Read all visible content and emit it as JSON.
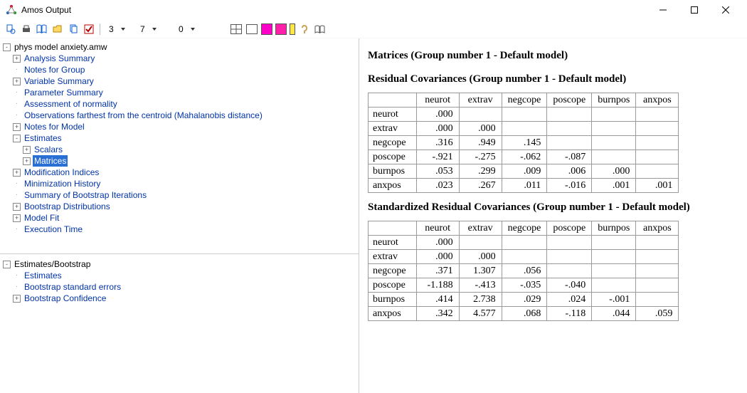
{
  "window": {
    "title": "Amos Output"
  },
  "toolbar": {
    "combo1": "3",
    "combo2": "7",
    "combo3": "0"
  },
  "tree1": [
    {
      "depth": 0,
      "twisty": "-",
      "label": "phys model anxiety.amw",
      "black": true
    },
    {
      "depth": 1,
      "twisty": "+",
      "label": "Analysis Summary"
    },
    {
      "depth": 1,
      "twisty": "",
      "label": "Notes for Group"
    },
    {
      "depth": 1,
      "twisty": "+",
      "label": "Variable Summary"
    },
    {
      "depth": 1,
      "twisty": "",
      "label": "Parameter Summary"
    },
    {
      "depth": 1,
      "twisty": "",
      "label": "Assessment of normality"
    },
    {
      "depth": 1,
      "twisty": "",
      "label": "Observations farthest from the centroid (Mahalanobis distance)"
    },
    {
      "depth": 1,
      "twisty": "+",
      "label": "Notes for Model"
    },
    {
      "depth": 1,
      "twisty": "-",
      "label": "Estimates"
    },
    {
      "depth": 2,
      "twisty": "+",
      "label": "Scalars"
    },
    {
      "depth": 2,
      "twisty": "+",
      "label": "Matrices",
      "selected": true
    },
    {
      "depth": 1,
      "twisty": "+",
      "label": "Modification Indices"
    },
    {
      "depth": 1,
      "twisty": "",
      "label": "Minimization History"
    },
    {
      "depth": 1,
      "twisty": "",
      "label": "Summary of Bootstrap Iterations"
    },
    {
      "depth": 1,
      "twisty": "+",
      "label": "Bootstrap Distributions"
    },
    {
      "depth": 1,
      "twisty": "+",
      "label": "Model Fit"
    },
    {
      "depth": 1,
      "twisty": "",
      "label": "Execution Time"
    }
  ],
  "tree2": [
    {
      "depth": 0,
      "twisty": "-",
      "label": "Estimates/Bootstrap",
      "black": true
    },
    {
      "depth": 1,
      "twisty": "",
      "label": "Estimates"
    },
    {
      "depth": 1,
      "twisty": "",
      "label": "Bootstrap standard errors"
    },
    {
      "depth": 1,
      "twisty": "+",
      "label": "Bootstrap Confidence"
    }
  ],
  "content": {
    "heading": "Matrices (Group number 1 - Default model)",
    "section1": "Residual Covariances (Group number 1 - Default model)",
    "section2": "Standardized Residual Covariances (Group number 1 - Default model)",
    "cols": [
      "neurot",
      "extrav",
      "negcope",
      "poscope",
      "burnpos",
      "anxpos"
    ],
    "rows": [
      "neurot",
      "extrav",
      "negcope",
      "poscope",
      "burnpos",
      "anxpos"
    ],
    "table1": [
      [
        ".000",
        "",
        "",
        "",
        "",
        ""
      ],
      [
        ".000",
        ".000",
        "",
        "",
        "",
        ""
      ],
      [
        ".316",
        ".949",
        ".145",
        "",
        "",
        ""
      ],
      [
        "-.921",
        "-.275",
        "-.062",
        "-.087",
        "",
        ""
      ],
      [
        ".053",
        ".299",
        ".009",
        ".006",
        ".000",
        ""
      ],
      [
        ".023",
        ".267",
        ".011",
        "-.016",
        ".001",
        ".001"
      ]
    ],
    "table2": [
      [
        ".000",
        "",
        "",
        "",
        "",
        ""
      ],
      [
        ".000",
        ".000",
        "",
        "",
        "",
        ""
      ],
      [
        ".371",
        "1.307",
        ".056",
        "",
        "",
        ""
      ],
      [
        "-1.188",
        "-.413",
        "-.035",
        "-.040",
        "",
        ""
      ],
      [
        ".414",
        "2.738",
        ".029",
        ".024",
        "-.001",
        ""
      ],
      [
        ".342",
        "4.577",
        ".068",
        "-.118",
        ".044",
        ".059"
      ]
    ]
  },
  "chart_data": {
    "type": "table",
    "title": "Residual and Standardized Residual Covariances (Group number 1 - Default model)",
    "variables": [
      "neurot",
      "extrav",
      "negcope",
      "poscope",
      "burnpos",
      "anxpos"
    ],
    "residual_covariances": {
      "neurot": {
        "neurot": 0.0
      },
      "extrav": {
        "neurot": 0.0,
        "extrav": 0.0
      },
      "negcope": {
        "neurot": 0.316,
        "extrav": 0.949,
        "negcope": 0.145
      },
      "poscope": {
        "neurot": -0.921,
        "extrav": -0.275,
        "negcope": -0.062,
        "poscope": -0.087
      },
      "burnpos": {
        "neurot": 0.053,
        "extrav": 0.299,
        "negcope": 0.009,
        "poscope": 0.006,
        "burnpos": 0.0
      },
      "anxpos": {
        "neurot": 0.023,
        "extrav": 0.267,
        "negcope": 0.011,
        "poscope": -0.016,
        "burnpos": 0.001,
        "anxpos": 0.001
      }
    },
    "standardized_residual_covariances": {
      "neurot": {
        "neurot": 0.0
      },
      "extrav": {
        "neurot": 0.0,
        "extrav": 0.0
      },
      "negcope": {
        "neurot": 0.371,
        "extrav": 1.307,
        "negcope": 0.056
      },
      "poscope": {
        "neurot": -1.188,
        "extrav": -0.413,
        "negcope": -0.035,
        "poscope": -0.04
      },
      "burnpos": {
        "neurot": 0.414,
        "extrav": 2.738,
        "negcope": 0.029,
        "poscope": 0.024,
        "burnpos": -0.001
      },
      "anxpos": {
        "neurot": 0.342,
        "extrav": 4.577,
        "negcope": 0.068,
        "poscope": -0.118,
        "burnpos": 0.044,
        "anxpos": 0.059
      }
    }
  }
}
